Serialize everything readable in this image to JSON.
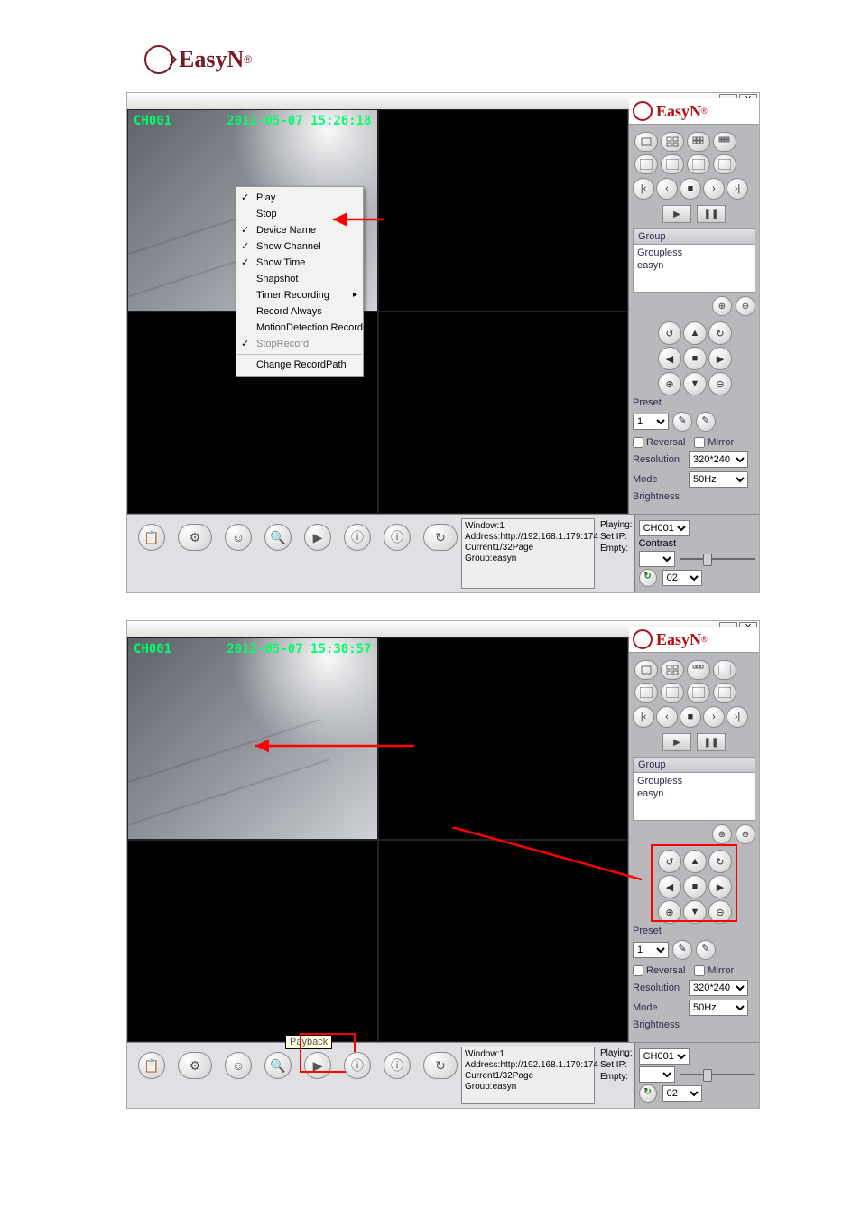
{
  "brand": {
    "name": "EasyN",
    "sup": "®"
  },
  "shot1": {
    "title_min": "−",
    "title_close": "X",
    "ch": "CH001",
    "ts": "2012-05-07 15:26:18",
    "ctx": {
      "play": "Play",
      "stop": "Stop",
      "device": "Device Name",
      "channel": "Show Channel",
      "time": "Show Time",
      "snapshot": "Snapshot",
      "timer": "Timer Recording",
      "always": "Record Always",
      "motion": "MotionDetection Record",
      "stoprec": "StopRecord",
      "path": "Change RecordPath"
    },
    "side": {
      "group_h": "Group",
      "groupless": "Groupless",
      "easyn": "easyn",
      "preset_lbl": "Preset",
      "preset_val": "1",
      "reversal": "Reversal",
      "mirror": "Mirror",
      "res_lbl": "Resolution",
      "res_val": "320*240",
      "mode_lbl": "Mode",
      "mode_val": "50Hz",
      "brightness": "Brightness"
    },
    "status": {
      "l1": "Window:1",
      "l2": "Address:http://192.168.1.179:174",
      "l3": "Current1/32Page",
      "l4": "Group:easyn",
      "playing_lbl": "Playing:",
      "setip_lbl": "Set IP:",
      "empty_lbl": "Empty:"
    },
    "sel": {
      "playing_val": "CH001",
      "contrast": "Contrast",
      "empty_val": "02"
    }
  },
  "shot2": {
    "ch": "CH001",
    "ts": "2012-05-07 15:30:57",
    "tooltip": "Payback",
    "side": {
      "group_h": "Group",
      "groupless": "Groupless",
      "easyn": "easyn",
      "preset_lbl": "Preset",
      "preset_val": "1",
      "reversal": "Reversal",
      "mirror": "Mirror",
      "res_lbl": "Resolution",
      "res_val": "320*240",
      "mode_lbl": "Mode",
      "mode_val": "50Hz",
      "brightness": "Brightness"
    },
    "status": {
      "l1": "Window:1",
      "l2": "Address:http://192.168.1.179:174",
      "l3": "Current1/32Page",
      "l4": "Group:easyn",
      "playing_lbl": "Playing:",
      "setip_lbl": "Set IP:",
      "empty_lbl": "Empty:"
    },
    "sel": {
      "playing_val": "CH001",
      "empty_val": "02"
    }
  }
}
